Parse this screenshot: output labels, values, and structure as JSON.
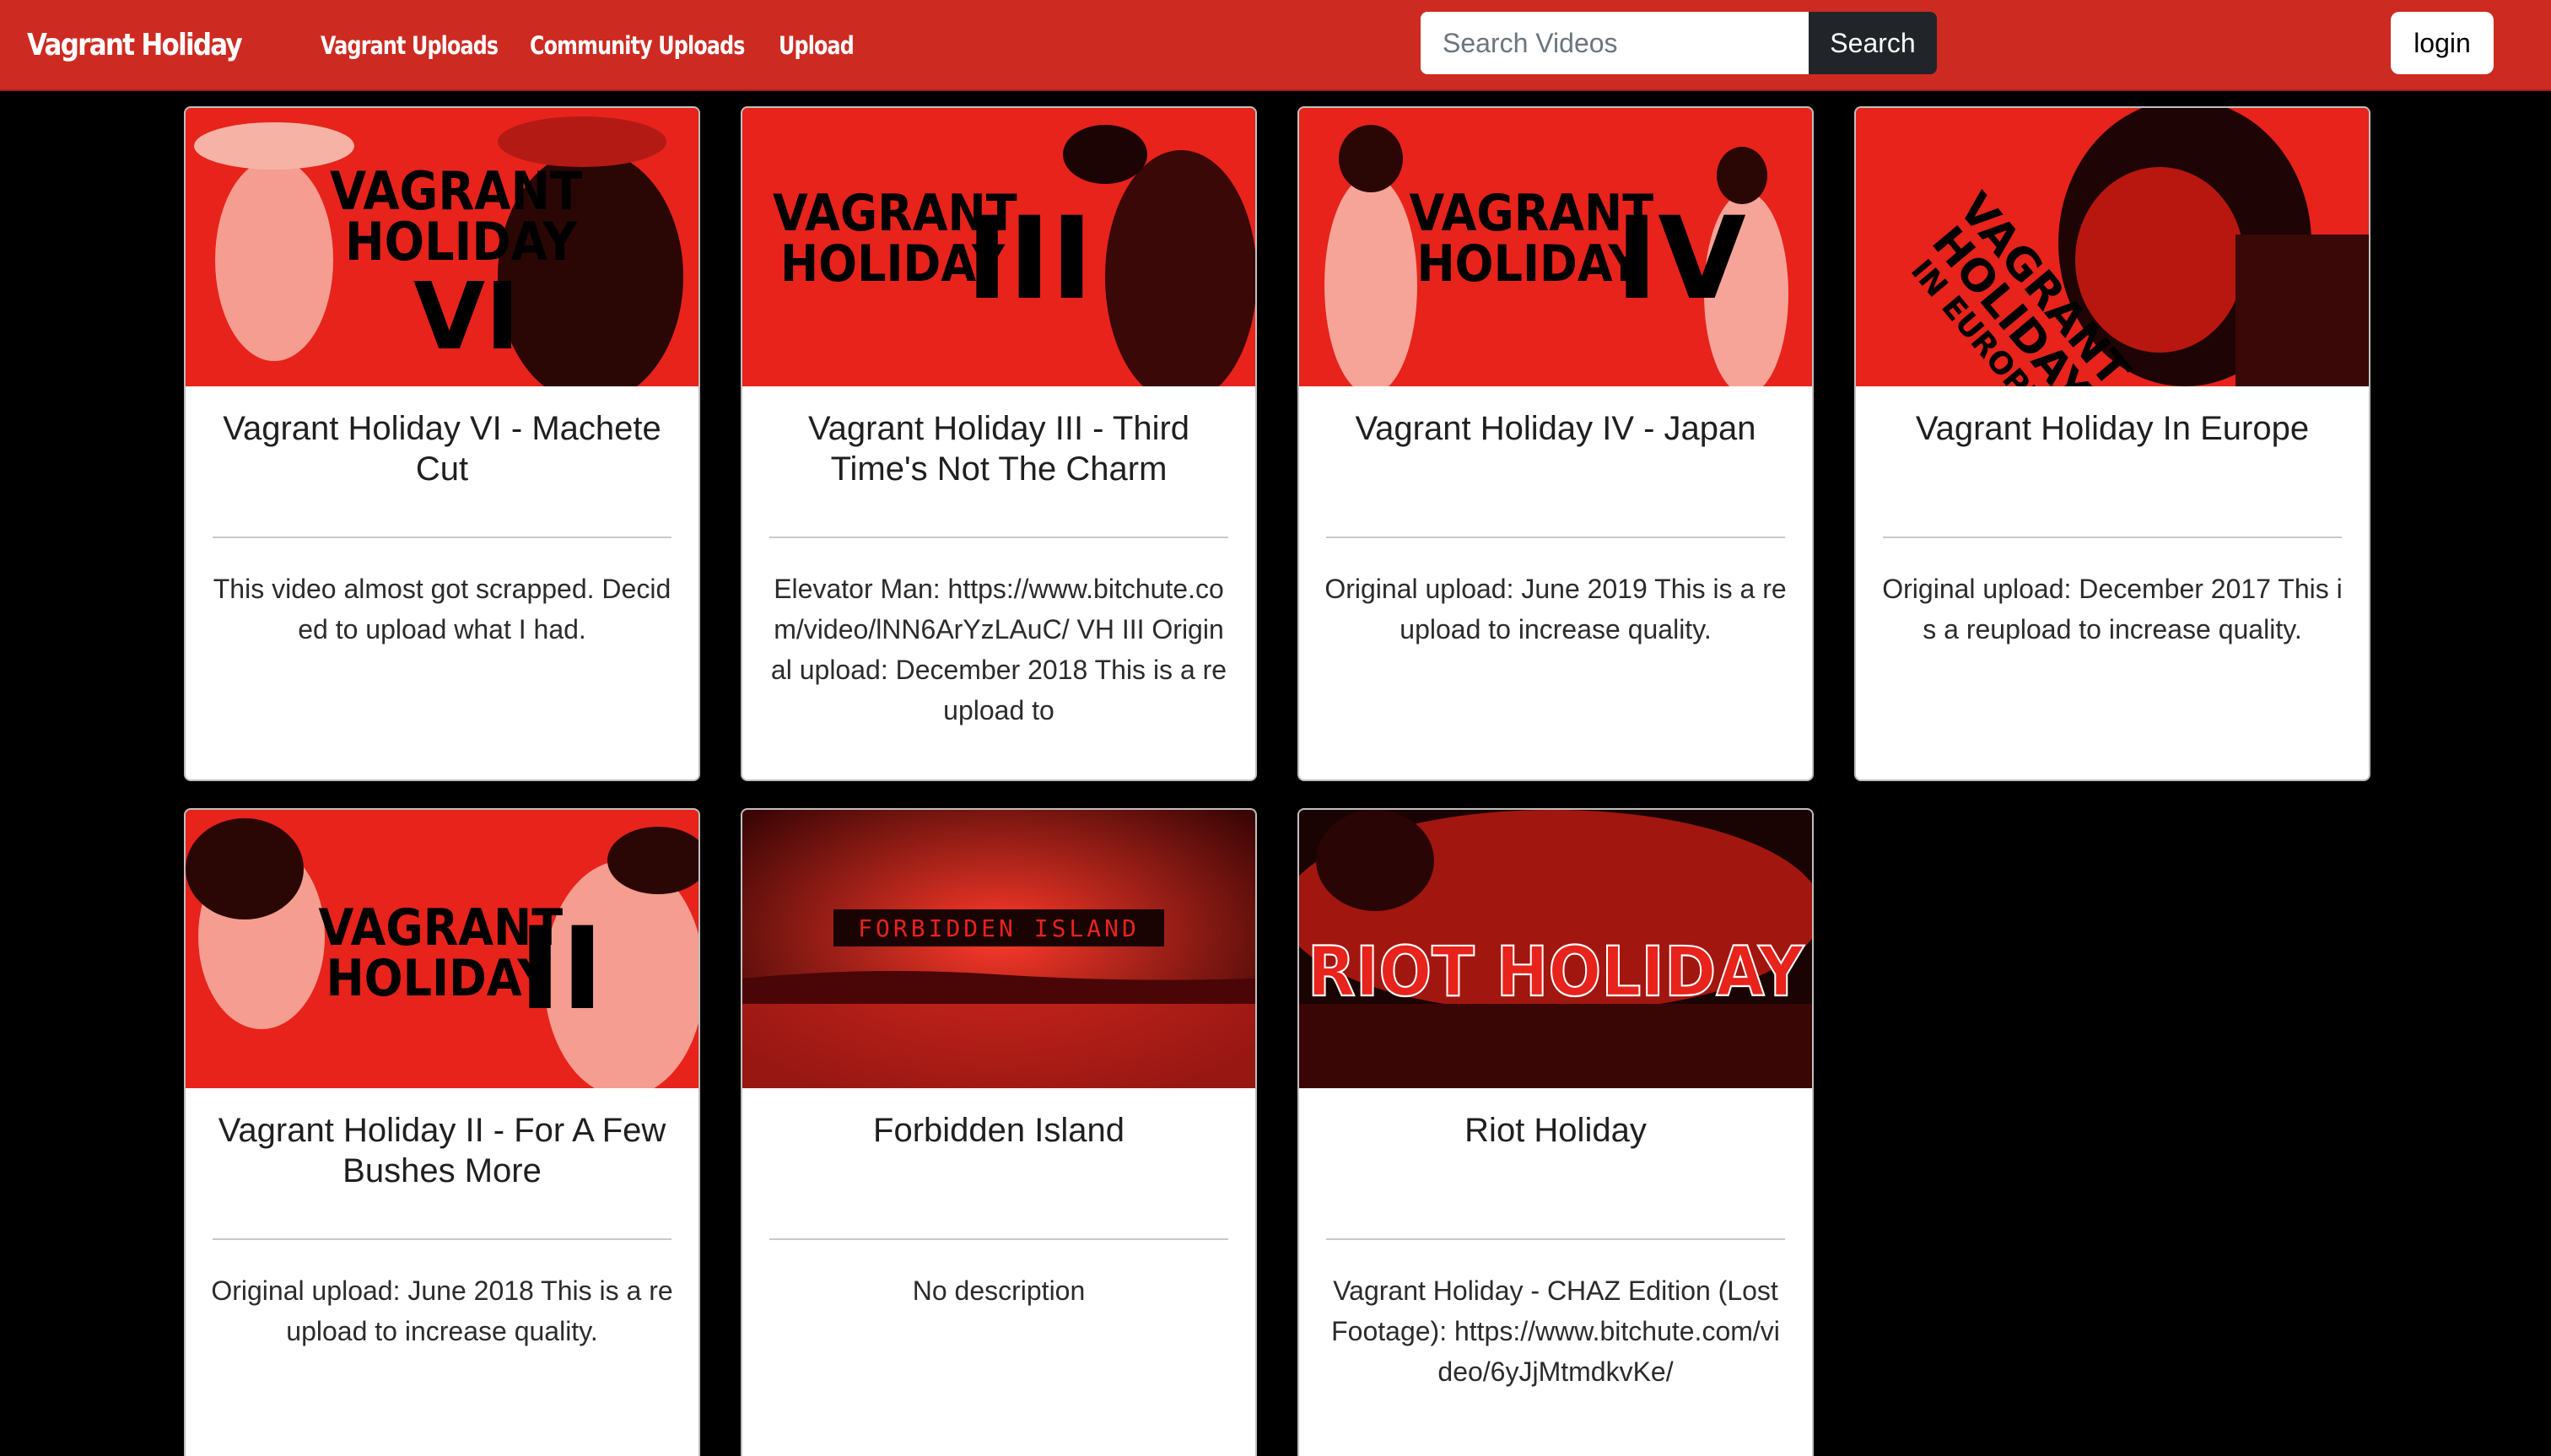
{
  "nav": {
    "brand": "Vagrant Holiday",
    "links": [
      {
        "label": "Vagrant Uploads"
      },
      {
        "label": "Community Uploads"
      },
      {
        "label": "Upload"
      }
    ],
    "search": {
      "placeholder": "Search Videos",
      "value": "",
      "button": "Search"
    },
    "login": "login"
  },
  "colors": {
    "navbar": "#cd2a22",
    "thumbnail_red": "#e7231c",
    "background": "#000000"
  },
  "videos": [
    {
      "title": "Vagrant Holiday VI - Machete Cut",
      "description": "This video almost got scrapped. Decided to upload what I had.",
      "thumb_text": [
        "VAGRANT",
        "HOLIDAY",
        "VI"
      ]
    },
    {
      "title": "Vagrant Holiday III - Third Time's Not The Charm",
      "description": "Elevator Man: https://www.bitchute.com/video/lNN6ArYzLAuC/ VH III Original upload: December 2018 This is a reupload to",
      "thumb_text": [
        "VAGRANT",
        "HOLIDAY",
        "III"
      ]
    },
    {
      "title": "Vagrant Holiday IV - Japan",
      "description": "Original upload: June 2019 This is a reupload to increase quality.",
      "thumb_text": [
        "VAGRANT",
        "HOLIDAY",
        "IV"
      ]
    },
    {
      "title": "Vagrant Holiday In Europe",
      "description": "Original upload: December 2017 This is a reupload to increase quality.",
      "thumb_text": [
        "VAGRANT",
        "HOLIDAY",
        "IN EUROPE"
      ]
    },
    {
      "title": "Vagrant Holiday II - For A Few Bushes More",
      "description": "Original upload: June 2018 This is a reupload to increase quality.",
      "thumb_text": [
        "VAGRANT",
        "HOLIDAY",
        "II"
      ]
    },
    {
      "title": "Forbidden Island",
      "description": "No description",
      "thumb_text": [
        "FORBIDDEN ISLAND"
      ]
    },
    {
      "title": "Riot Holiday",
      "description": "Vagrant Holiday - CHAZ Edition (Lost Footage): https://www.bitchute.com/video/6yJjMtmdkvKe/",
      "thumb_text": [
        "RIOT HOLIDAY"
      ]
    }
  ]
}
